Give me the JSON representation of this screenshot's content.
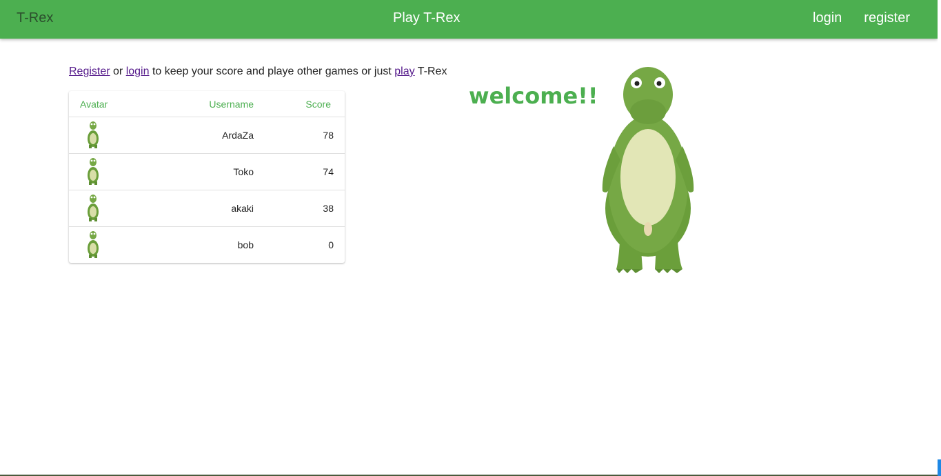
{
  "header": {
    "brand": "T-Rex",
    "center_link": "Play T-Rex",
    "nav": [
      "login",
      "register"
    ]
  },
  "intro": {
    "register_link": "Register",
    "or_text": " or ",
    "login_link": "login",
    "middle_text": " to keep your score and playe other games or just ",
    "play_link": "play",
    "end_text": " T-Rex"
  },
  "table": {
    "headers": {
      "avatar": "Avatar",
      "username": "Username",
      "score": "Score"
    },
    "rows": [
      {
        "username": "ArdaZa",
        "score": "78",
        "avatar": "trex-avatar-icon"
      },
      {
        "username": "Toko",
        "score": "74",
        "avatar": "trex-avatar-icon"
      },
      {
        "username": "akaki",
        "score": "38",
        "avatar": "trex-avatar-icon"
      },
      {
        "username": "bob",
        "score": "0",
        "avatar": "trex-avatar-icon"
      }
    ]
  },
  "welcome": "welcome!!",
  "colors": {
    "primary": "#4caf50",
    "brand_text": "#2c4f2d",
    "link_visited": "#551a8b"
  }
}
